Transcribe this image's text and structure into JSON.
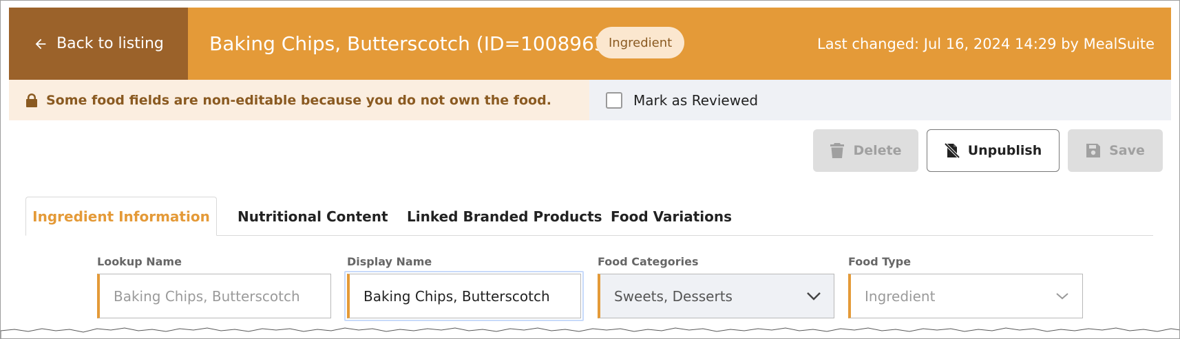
{
  "header": {
    "back_label": "Back to listing",
    "title": "Baking Chips, Butterscotch (ID=1008963)",
    "type_badge": "Ingredient",
    "last_changed": "Last changed: Jul 16, 2024 14:29 by MealSuite",
    "colors": {
      "bar": "#e49a38",
      "back": "#9b622a"
    }
  },
  "notice": {
    "text": "Some food fields are non-editable because you do not own the food.",
    "icon": "lock-icon"
  },
  "review": {
    "label": "Mark as Reviewed",
    "checked": false
  },
  "actions": {
    "delete_label": "Delete",
    "unpublish_label": "Unpublish",
    "save_label": "Save"
  },
  "tabs": [
    {
      "label": "Ingredient Information",
      "active": true
    },
    {
      "label": "Nutritional Content",
      "active": false
    },
    {
      "label": "Linked Branded Products",
      "active": false
    },
    {
      "label": "Food Variations",
      "active": false
    }
  ],
  "form": {
    "lookup_name": {
      "label": "Lookup Name",
      "value": "Baking Chips, Butterscotch"
    },
    "display_name": {
      "label": "Display Name",
      "value": "Baking Chips, Butterscotch"
    },
    "food_categories": {
      "label": "Food Categories",
      "value": "Sweets, Desserts"
    },
    "food_type": {
      "label": "Food Type",
      "value": "Ingredient"
    }
  }
}
